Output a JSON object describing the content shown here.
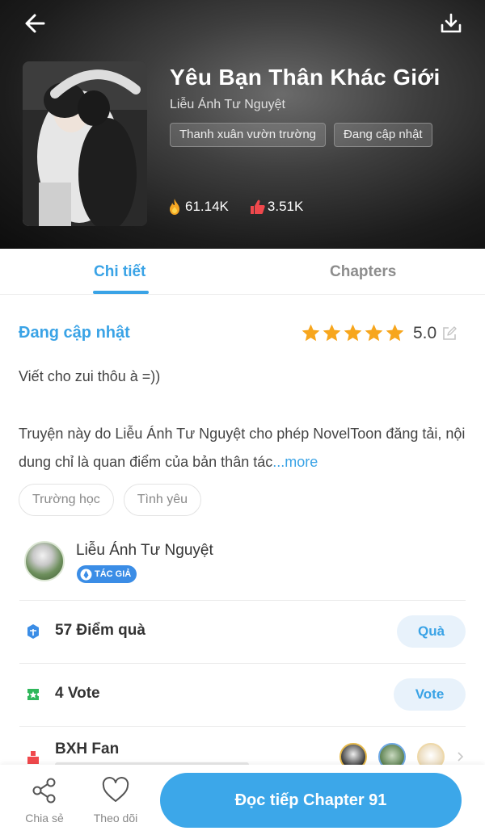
{
  "header": {
    "back_icon": "arrow-left-icon",
    "download_icon": "download-icon",
    "title": "Yêu Bạn Thân Khác Giới",
    "author": "Liễu Ánh Tư Nguyệt",
    "tags": [
      "Thanh xuân vườn trường",
      "Đang cập nhật"
    ],
    "stats": {
      "views": "61.14K",
      "likes": "3.51K"
    }
  },
  "tabs": [
    {
      "label": "Chi tiết",
      "active": true
    },
    {
      "label": "Chapters",
      "active": false
    }
  ],
  "detail": {
    "status": "Đang cập nhật",
    "rating": {
      "stars": 5,
      "value": "5.0"
    },
    "summary": "Viết cho zui thôu à =))",
    "notice": "Truyện này do Liễu Ánh Tư Nguyệt cho phép NovelToon đăng tải, nội dung chỉ là quan điểm của bản thân tác",
    "more_label": "...more",
    "genres": [
      "Trường học",
      "Tình yêu"
    ]
  },
  "author_section": {
    "name": "Liễu Ánh Tư Nguyệt",
    "badge": "TÁC GIẢ"
  },
  "gift": {
    "label": "57 Điểm quà",
    "button": "Quà"
  },
  "vote": {
    "label": "4 Vote",
    "button": "Vote"
  },
  "fan": {
    "label": "BXH Fan"
  },
  "bottom_bar": {
    "share_label": "Chia sẻ",
    "follow_label": "Theo dõi",
    "read_button": "Đọc tiếp Chapter 91"
  },
  "colors": {
    "accent": "#3aa3e6",
    "read_button": "#3ca7e9",
    "star": "#f7a61d",
    "flame": "#f5a623",
    "like": "#f0484c",
    "gift_icon": "#3b8de6",
    "vote_icon": "#2fb75b",
    "fan_icon": "#f0484c"
  }
}
